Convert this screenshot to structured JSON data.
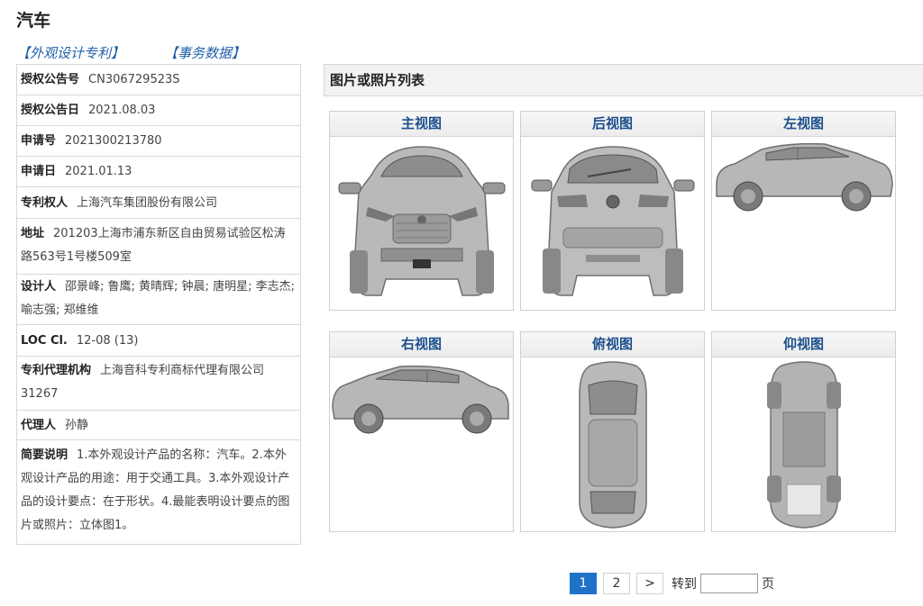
{
  "page": {
    "title": "汽车"
  },
  "links": {
    "design_patent": "【外观设计专利】",
    "business_data": "【事务数据】"
  },
  "info": [
    {
      "label": "授权公告号",
      "value": "CN306729523S"
    },
    {
      "label": "授权公告日",
      "value": "2021.08.03"
    },
    {
      "label": "申请号",
      "value": "2021300213780"
    },
    {
      "label": "申请日",
      "value": "2021.01.13"
    },
    {
      "label": "专利权人",
      "value": "上海汽车集团股份有限公司"
    },
    {
      "label": "地址",
      "value": "201203上海市浦东新区自由贸易试验区松涛路563号1号楼509室"
    },
    {
      "label": "设计人",
      "value": "邵景峰; 鲁鹰; 黄晴辉; 钟晨; 唐明星; 李志杰; 喻志强; 郑维维"
    },
    {
      "label": "LOC Cl.",
      "value": "12-08 (13)"
    },
    {
      "label": "专利代理机构",
      "value": "上海音科专利商标代理有限公司 31267"
    },
    {
      "label": "代理人",
      "value": "孙静"
    },
    {
      "label": "简要说明",
      "value": "1.本外观设计产品的名称：汽车。2.本外观设计产品的用途：用于交通工具。3.本外观设计产品的设计要点：在于形状。4.最能表明设计要点的图片或照片：立体图1。"
    }
  ],
  "gallery": {
    "header": "图片或照片列表",
    "views": [
      {
        "label": "主视图"
      },
      {
        "label": "后视图"
      },
      {
        "label": "左视图"
      },
      {
        "label": "右视图"
      },
      {
        "label": "俯视图"
      },
      {
        "label": "仰视图"
      }
    ]
  },
  "pagination": {
    "pages": [
      "1",
      "2"
    ],
    "current": "1",
    "next": ">",
    "goto_label": "转到",
    "goto_value": "",
    "suffix": "页"
  }
}
